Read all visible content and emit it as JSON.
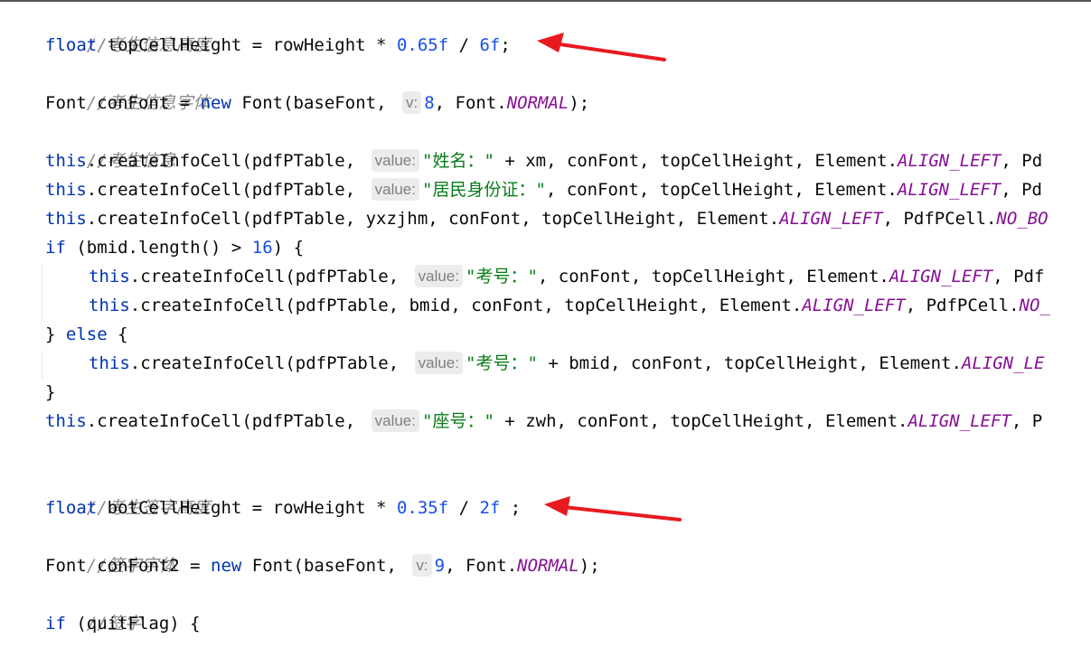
{
  "code": {
    "l1_comment": "//考生信息高度",
    "l2": {
      "kw": "float",
      "a": " topCellHeight = rowHeight * ",
      "n1": "0.65f",
      "b": " / ",
      "n2": "6f",
      "c": ";"
    },
    "l3_comment": "//考生信息字体",
    "l4": {
      "a": "Font conFont = ",
      "kw": "new",
      "b": " Font(baseFont, ",
      "hint": "v:",
      "n": "8",
      "c": ", Font.",
      "const": "NORMAL",
      "d": ");"
    },
    "l5_comment": "//考生信息",
    "l6": {
      "kw": "this",
      "a": ".createInfoCell(pdfPTable, ",
      "hint": "value:",
      "str": "\"姓名：\"",
      "b": " + xm, conFont, topCellHeight, Element.",
      "const": "ALIGN_LEFT",
      "c": ", Pd"
    },
    "l7": {
      "kw": "this",
      "a": ".createInfoCell(pdfPTable, ",
      "hint": "value:",
      "str": "\"居民身份证：\"",
      "b": ", conFont, topCellHeight, Element.",
      "const": "ALIGN_LEFT",
      "c": ", Pd"
    },
    "l8": {
      "kw": "this",
      "a": ".createInfoCell(pdfPTable, yxzjhm, conFont, topCellHeight, Element.",
      "const": "ALIGN_LEFT",
      "b": ", PdfPCell.",
      "const2": "NO_BO"
    },
    "l9": {
      "kw": "if",
      "a": " (bmid.length() > ",
      "n": "16",
      "b": ") {"
    },
    "l10": {
      "kw": "this",
      "a": ".createInfoCell(pdfPTable, ",
      "hint": "value:",
      "str": "\"考号：\"",
      "b": ", conFont, topCellHeight, Element.",
      "const": "ALIGN_LEFT",
      "c": ", Pdf"
    },
    "l11": {
      "kw": "this",
      "a": ".createInfoCell(pdfPTable, bmid, conFont, topCellHeight, Element.",
      "const": "ALIGN_LEFT",
      "b": ", PdfPCell.",
      "const2": "NO_"
    },
    "l12": {
      "a": "} ",
      "kw": "else",
      "b": " {"
    },
    "l13": {
      "kw": "this",
      "a": ".createInfoCell(pdfPTable, ",
      "hint": "value:",
      "str": "\"考号：\"",
      "b": " + bmid, conFont, topCellHeight, Element.",
      "const": "ALIGN_LE"
    },
    "l14": "}",
    "l15": {
      "kw": "this",
      "a": ".createInfoCell(pdfPTable, ",
      "hint": "value:",
      "str": "\"座号：\"",
      "b": " + zwh, conFont, topCellHeight, Element.",
      "const": "ALIGN_LEFT",
      "c": ", P"
    },
    "l17_comment": "//考生签字高度",
    "l18": {
      "kw": "float",
      "a": " botCellHeight = rowHeight * ",
      "n1": "0.35f",
      "b": " / ",
      "n2": "2f",
      "c": " ;"
    },
    "l19_comment": "//签字字体",
    "l20": {
      "a": "Font conFont2 = ",
      "kw": "new",
      "b": " Font(baseFont, ",
      "hint": "v:",
      "n": "9",
      "c": ", Font.",
      "const": "NORMAL",
      "d": ");"
    },
    "l21_comment": "//签字",
    "l22": {
      "kw": "if",
      "a": " (quitFlag) {"
    }
  },
  "colors": {
    "keyword": "#0033b3",
    "number": "#1750eb",
    "string": "#067d17",
    "constant": "#871094",
    "comment": "#8c8c8c",
    "arrow": "#e8191f"
  },
  "icons": [
    "arrow-annotation"
  ]
}
